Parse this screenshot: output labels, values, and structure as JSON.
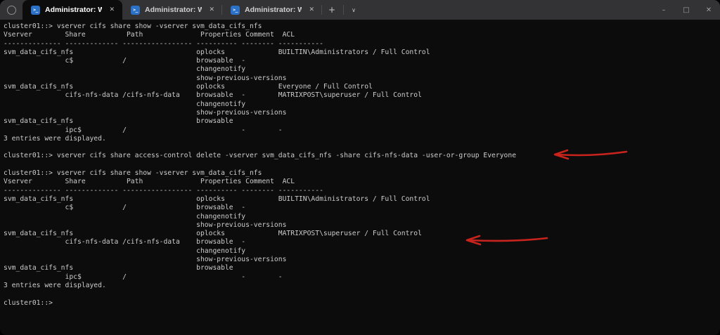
{
  "colors": {
    "titlebar_bg": "#333335",
    "tab_active_bg": "#0c0c0c",
    "terminal_bg": "#0c0c0c",
    "terminal_fg": "#cccccc",
    "ps_icon_bg": "#2b71c8",
    "annotation": "#c8231c"
  },
  "icons": {
    "powershell_glyph": ">_",
    "close": "✕",
    "new_tab": "+",
    "dropdown": "∨",
    "minimize": "–",
    "maximize": "□",
    "window_close": "✕"
  },
  "tabs": [
    {
      "label": "Administrator: Windows Powe",
      "active": true
    },
    {
      "label": "Administrator: Windows Powe",
      "active": false
    },
    {
      "label": "Administrator: Windows Powe",
      "active": false
    }
  ],
  "terminal": {
    "lines": [
      "cluster01::> vserver cifs share show -vserver svm_data_cifs_nfs",
      "Vserver        Share          Path              Properties Comment  ACL",
      "-------------- ------------- ----------------- ---------- -------- -----------",
      "svm_data_cifs_nfs                              oplocks             BUILTIN\\Administrators / Full Control",
      "               c$            /                 browsable  -",
      "                                               changenotify",
      "                                               show-previous-versions",
      "svm_data_cifs_nfs                              oplocks             Everyone / Full Control",
      "               cifs-nfs-data /cifs-nfs-data    browsable  -        MATRIXPOST\\superuser / Full Control",
      "                                               changenotify",
      "                                               show-previous-versions",
      "svm_data_cifs_nfs                              browsable",
      "               ipc$          /                            -        -",
      "3 entries were displayed.",
      "",
      "cluster01::> vserver cifs share access-control delete -vserver svm_data_cifs_nfs -share cifs-nfs-data -user-or-group Everyone",
      "",
      "cluster01::> vserver cifs share show -vserver svm_data_cifs_nfs",
      "Vserver        Share          Path              Properties Comment  ACL",
      "-------------- ------------- ----------------- ---------- -------- -----------",
      "svm_data_cifs_nfs                              oplocks             BUILTIN\\Administrators / Full Control",
      "               c$            /                 browsable  -",
      "                                               changenotify",
      "                                               show-previous-versions",
      "svm_data_cifs_nfs                              oplocks             MATRIXPOST\\superuser / Full Control",
      "               cifs-nfs-data /cifs-nfs-data    browsable  -",
      "                                               changenotify",
      "                                               show-previous-versions",
      "svm_data_cifs_nfs                              browsable",
      "               ipc$          /                            -        -",
      "3 entries were displayed.",
      "",
      "cluster01::>"
    ]
  }
}
